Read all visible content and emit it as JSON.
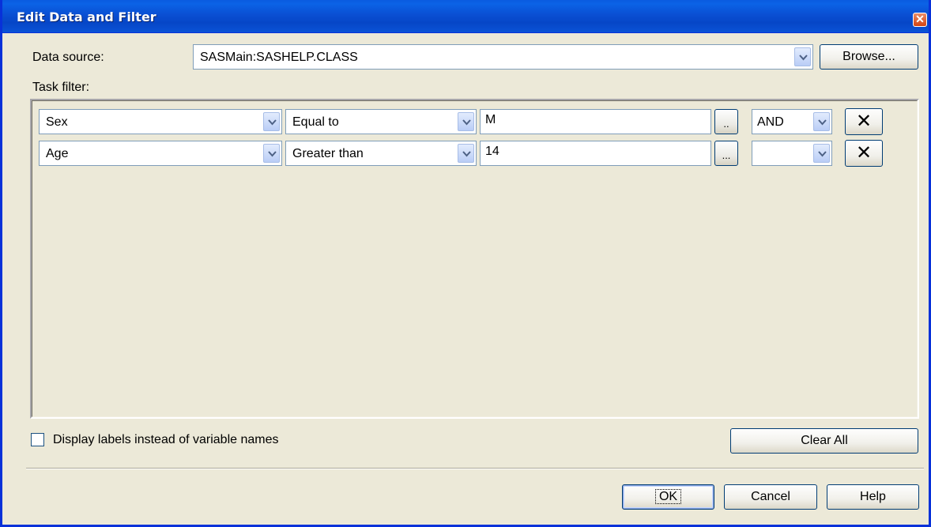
{
  "window": {
    "title": "Edit Data and Filter",
    "close_glyph": "✕"
  },
  "data_source": {
    "label": "Data source:",
    "value": "SASMain:SASHELP.CLASS",
    "browse_label": "Browse..."
  },
  "task_filter": {
    "label": "Task filter:",
    "rows": [
      {
        "variable": "Sex",
        "operator": "Equal to",
        "value": "M",
        "ellipsis": "..",
        "connector": "AND",
        "delete": "✕"
      },
      {
        "variable": "Age",
        "operator": "Greater than",
        "value": "14",
        "ellipsis": "...",
        "connector": "",
        "delete": "✕"
      }
    ]
  },
  "options": {
    "display_labels": "Display labels instead of variable names",
    "display_labels_checked": false
  },
  "buttons": {
    "clear_all": "Clear All",
    "ok": "OK",
    "cancel": "Cancel",
    "help": "Help"
  },
  "icons": {
    "dropdown": "chevron-down-icon",
    "close": "close-icon",
    "delete": "x-icon"
  }
}
